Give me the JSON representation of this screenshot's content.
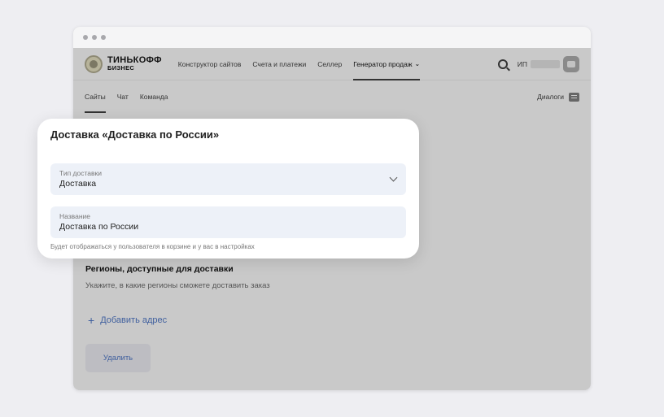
{
  "brand": {
    "name": "ТИНЬКОФФ",
    "sub": "БИЗНЕС"
  },
  "topnav": {
    "items": [
      {
        "label": "Конструктор сайтов"
      },
      {
        "label": "Счета и платежи"
      },
      {
        "label": "Селлер"
      },
      {
        "label": "Генератор продаж"
      }
    ],
    "user_prefix": "ИП"
  },
  "subnav": {
    "tabs": [
      {
        "label": "Сайты"
      },
      {
        "label": "Чат"
      },
      {
        "label": "Команда"
      }
    ],
    "dialogs_label": "Диалоги"
  },
  "modal": {
    "title": "Доставка «Доставка по России»",
    "delivery_type": {
      "label": "Тип доставки",
      "value": "Доставка"
    },
    "name": {
      "label": "Название",
      "value": "Доставка по России"
    },
    "hint": "Будет отображаться у пользователя в корзине и у вас в настройках"
  },
  "regions": {
    "title": "Регионы, доступные для доставки",
    "subtitle": "Укажите, в какие регионы сможете доставить заказ"
  },
  "add_address_label": "Добавить адрес",
  "delete_label": "Удалить",
  "colors": {
    "accent": "#3f5f9e",
    "field_bg": "#edf1f8",
    "overlay": "#c9c9c9"
  }
}
